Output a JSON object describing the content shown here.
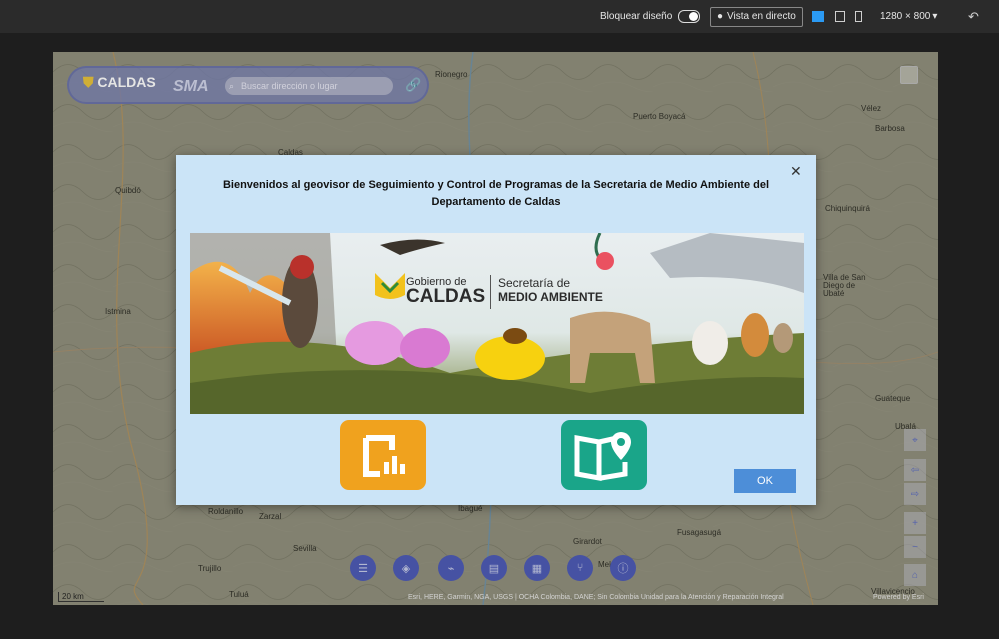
{
  "topbar": {
    "lock_design_label": "Bloquear diseño",
    "live_view_label": "Vista en directo",
    "resolution": "1280 × 800"
  },
  "map": {
    "logo_top": "Gobierno de",
    "logo_text": "CALDAS",
    "app_label": "SMA",
    "search_placeholder": "Buscar dirección o lugar",
    "places": [
      "Rionegro",
      "Puerto Boyacá",
      "Vélez",
      "Barbosa",
      "Caldas",
      "Quibdó",
      "Chiquinquirá",
      "Villa de San Diego de Ubaté",
      "Istmina",
      "Girardot",
      "Fusagasugá",
      "Villavicencio",
      "Ibagué",
      "Sevilla",
      "Tuluá",
      "Zarzal",
      "Roldanillo",
      "Trujillo",
      "Melgar",
      "Guateque",
      "Ubalá"
    ],
    "scale_label": "20 km",
    "attribution": "Esri, HERE, Garmin, NGA, USGS | OCHA Colombia, DANE; Sin Colombia Unidad para la Atención y Reparación Integral",
    "powered_by": "Powered by Esri"
  },
  "modal": {
    "title": "Bienvenidos al geovisor de Seguimiento y Control de Programas de la Secretaria de Medio Ambiente del Departamento de Caldas",
    "banner": {
      "gov_line1": "Gobierno de",
      "gov_line2": "CALDAS",
      "sec_line1": "Secretaría de",
      "sec_line2": "MEDIO AMBIENTE"
    },
    "ok_label": "OK"
  },
  "colors": {
    "accent": "#4b58b6",
    "ok_button": "#4d8ed8",
    "modal_bg": "#cbe4f7",
    "icon_orange": "#f0a21e",
    "icon_teal": "#1aa589"
  }
}
